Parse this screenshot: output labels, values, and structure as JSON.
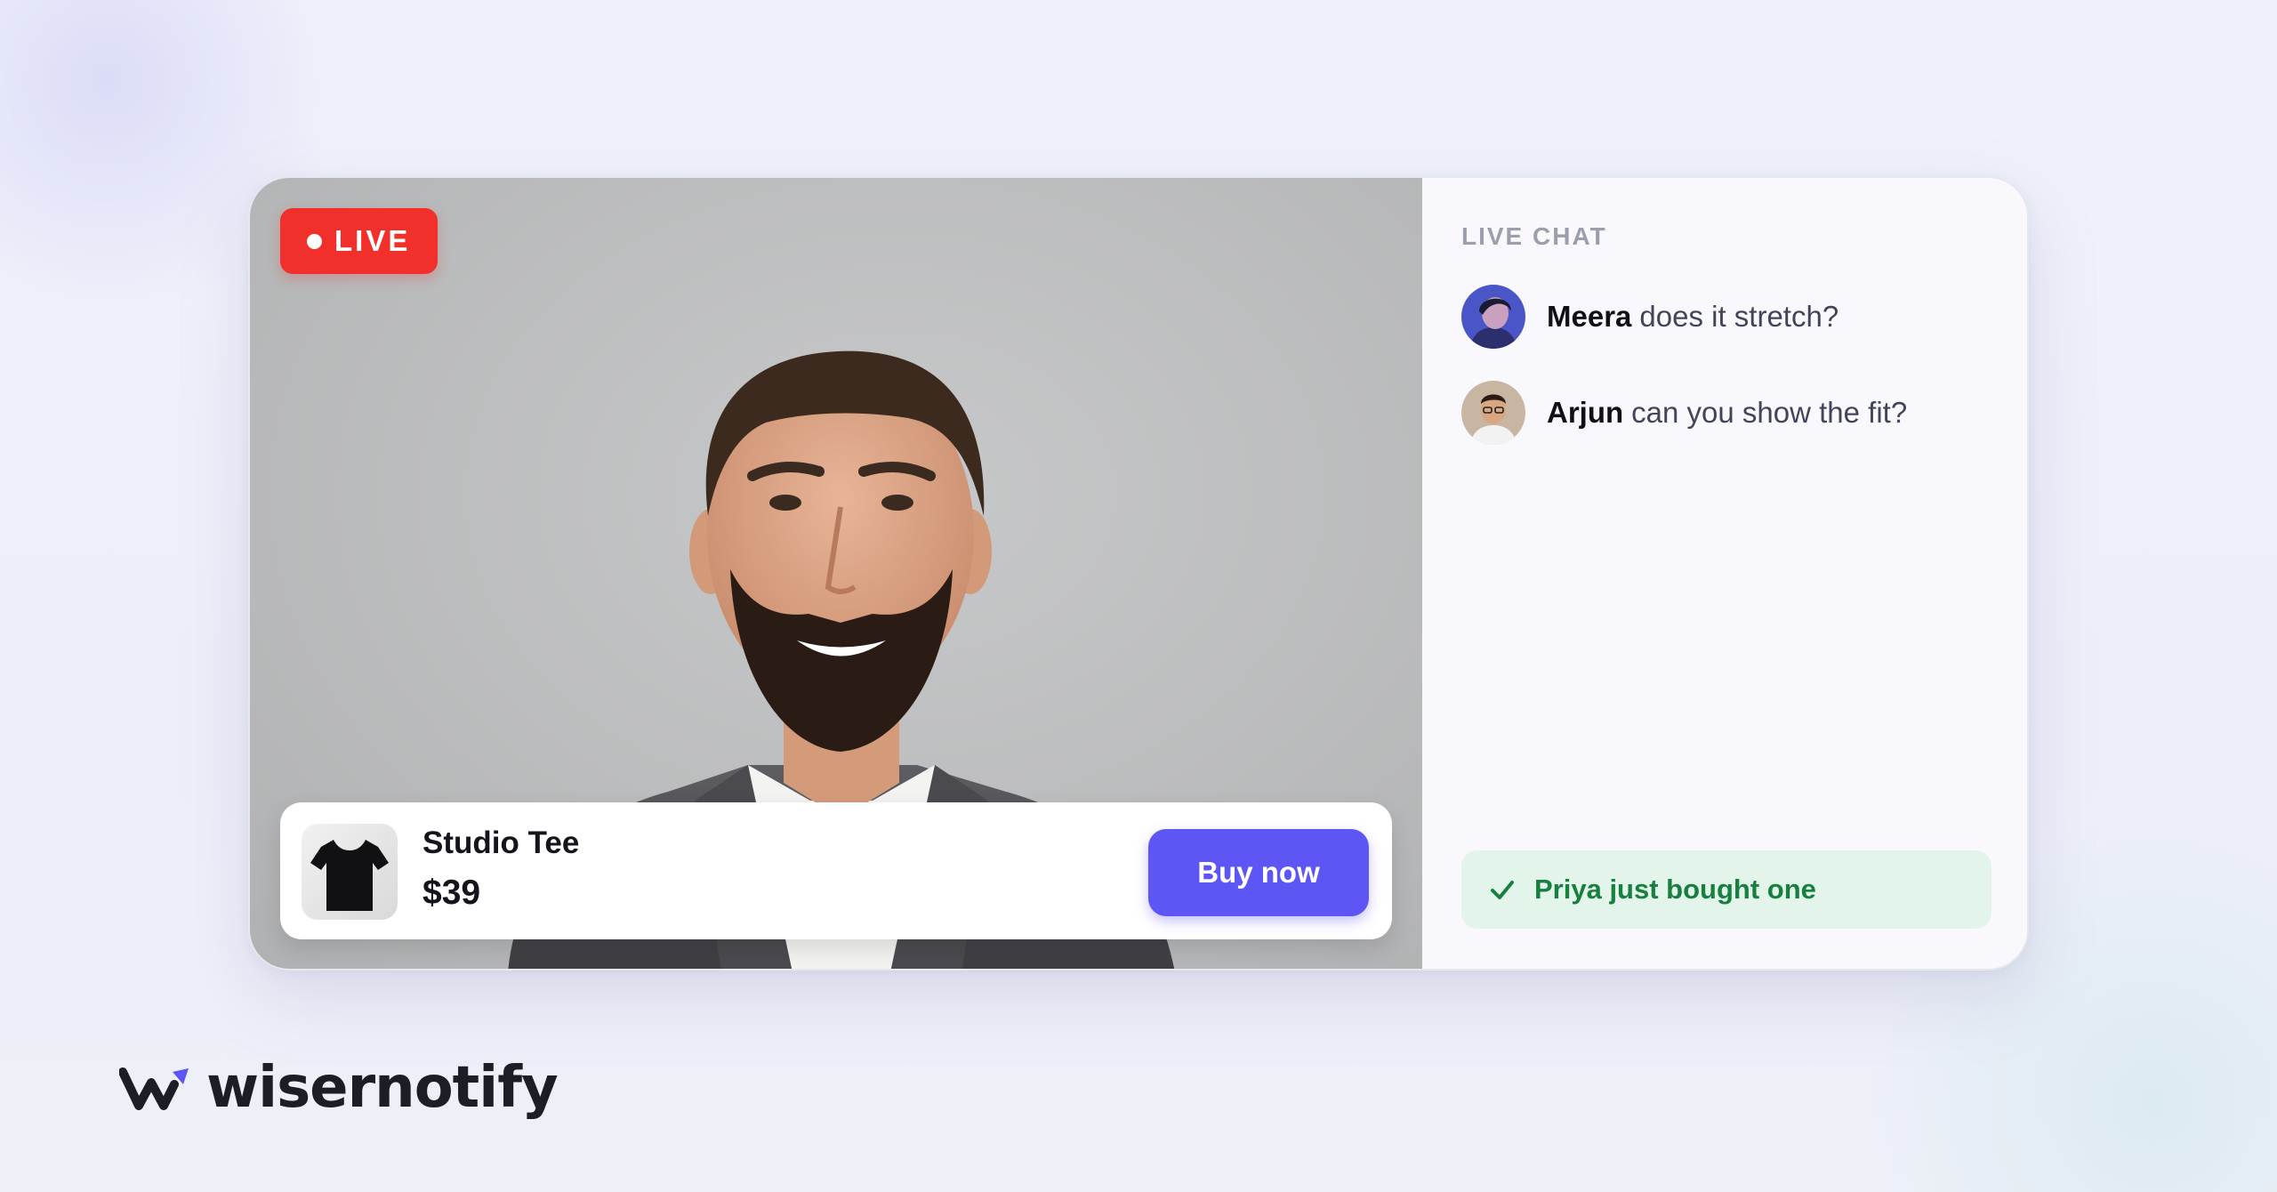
{
  "stream": {
    "live_label": "LIVE"
  },
  "product": {
    "name": "Studio Tee",
    "price": "$39",
    "buy_label": "Buy now"
  },
  "chat": {
    "title": "LIVE CHAT",
    "messages": [
      {
        "author": "Meera",
        "text": "does it stretch?"
      },
      {
        "author": "Arjun",
        "text": "can you show the fit?"
      }
    ],
    "purchase_toast": "Priya just bought one"
  },
  "brand": {
    "name": "wisernotify"
  },
  "colors": {
    "live_red": "#f1302b",
    "accent_purple": "#5e55f5",
    "success_green": "#17803f"
  }
}
